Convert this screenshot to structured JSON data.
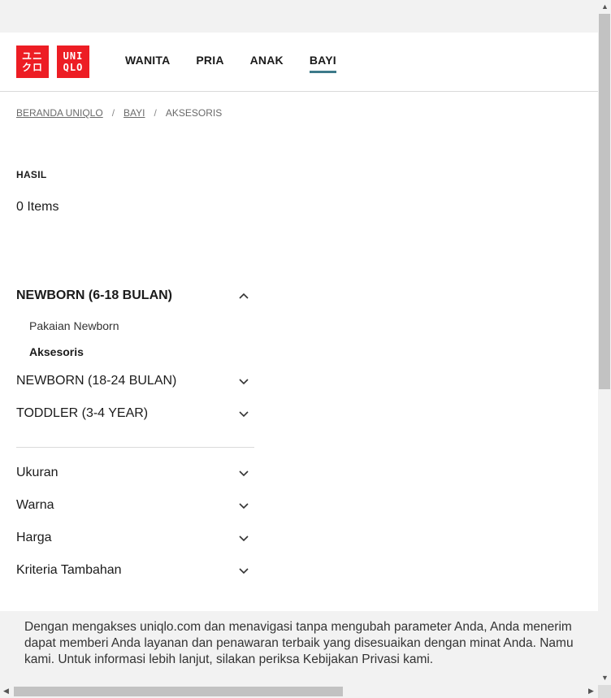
{
  "logo": {
    "box1": [
      "ユニ",
      "クロ"
    ],
    "box2": [
      "UNI",
      "QLO"
    ]
  },
  "nav": [
    {
      "label": "WANITA"
    },
    {
      "label": "PRIA"
    },
    {
      "label": "ANAK"
    },
    {
      "label": "BAYI",
      "active": true
    }
  ],
  "breadcrumb": {
    "home": "BERANDA UNIQLO",
    "sep": "/",
    "level1": "BAYI",
    "current": "AKSESORIS"
  },
  "results": {
    "heading": "HASIL",
    "count": "0 Items"
  },
  "filters": {
    "categories": [
      {
        "label": "NEWBORN (6-18 BULAN)",
        "expanded": true,
        "children": [
          {
            "label": "Pakaian Newborn",
            "selected": false
          },
          {
            "label": "Aksesoris",
            "selected": true
          }
        ]
      },
      {
        "label": "NEWBORN (18-24 BULAN)",
        "expanded": false
      },
      {
        "label": "TODDLER (3-4 YEAR)",
        "expanded": false
      }
    ],
    "facets": [
      {
        "label": "Ukuran"
      },
      {
        "label": "Warna"
      },
      {
        "label": "Harga"
      },
      {
        "label": "Kriteria Tambahan"
      }
    ]
  },
  "cookie_banner": {
    "line1": "Dengan mengakses uniqlo.com dan menavigasi tanpa mengubah parameter Anda, Anda menerim",
    "line2": "dapat memberi Anda layanan dan penawaran terbaik yang disesuaikan dengan minat Anda. Namu",
    "line3": "kami. Untuk informasi lebih lanjut, silakan periksa Kebijakan Privasi kami."
  },
  "colors": {
    "brand_red": "#ed1d24",
    "active_underline": "#3d7a8a"
  }
}
